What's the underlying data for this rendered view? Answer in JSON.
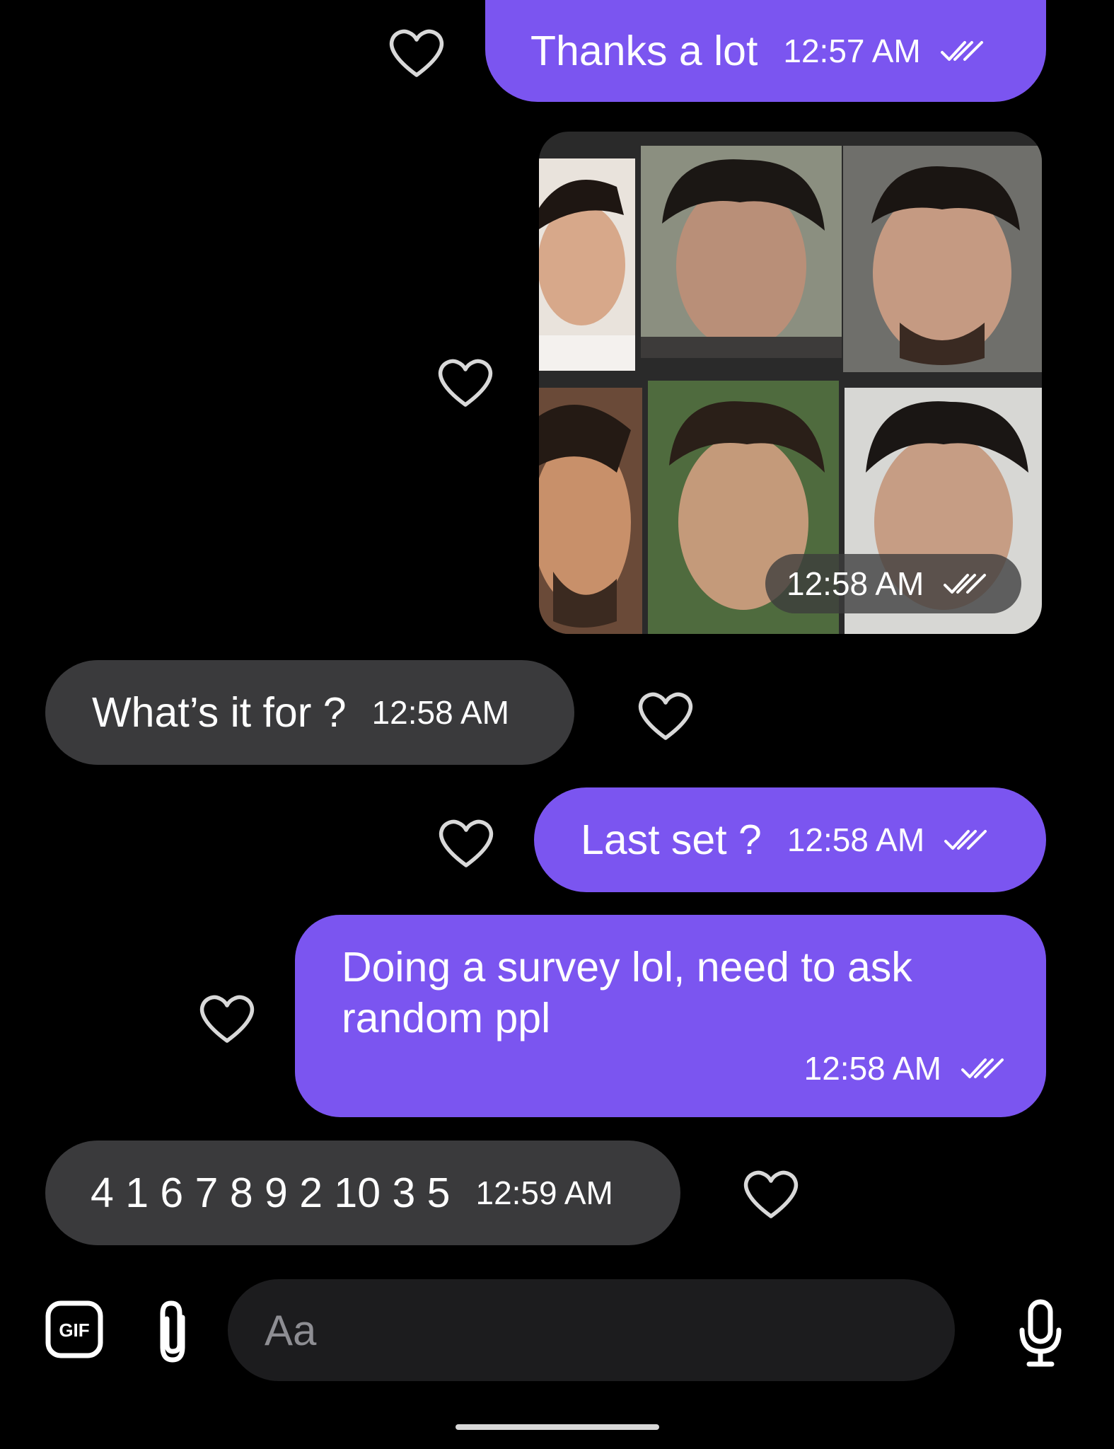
{
  "colors": {
    "outgoing_bubble": "#7b55f0",
    "incoming_bubble": "#3a3a3c",
    "background": "#000000",
    "composer_field": "#1c1c1e"
  },
  "messages": [
    {
      "direction": "outgoing",
      "text": "Thanks a lot",
      "time": "12:57 AM",
      "status": "read-double-check"
    },
    {
      "direction": "outgoing",
      "type": "photo",
      "alt": "grid of six portrait photos",
      "time": "12:58 AM",
      "status": "read-double-check"
    },
    {
      "direction": "incoming",
      "text": "What’s it for ?",
      "time": "12:58 AM"
    },
    {
      "direction": "outgoing",
      "text": "Last set ?",
      "time": "12:58 AM",
      "status": "read-double-check"
    },
    {
      "direction": "outgoing",
      "text_line1": "Doing a survey lol, need to ask",
      "text_line2": "random ppl",
      "time": "12:58 AM",
      "status": "read-double-check"
    },
    {
      "direction": "incoming",
      "text": "4 1 6 7 8 9 2 10 3 5",
      "time": "12:59 AM"
    }
  ],
  "composer": {
    "placeholder": "Aa",
    "gif_label": "GIF",
    "icons": [
      "gif-icon",
      "paperclip-icon",
      "microphone-icon"
    ]
  },
  "icons": {
    "reaction": "heart-outline-icon",
    "read_status": "double-check-icon"
  }
}
